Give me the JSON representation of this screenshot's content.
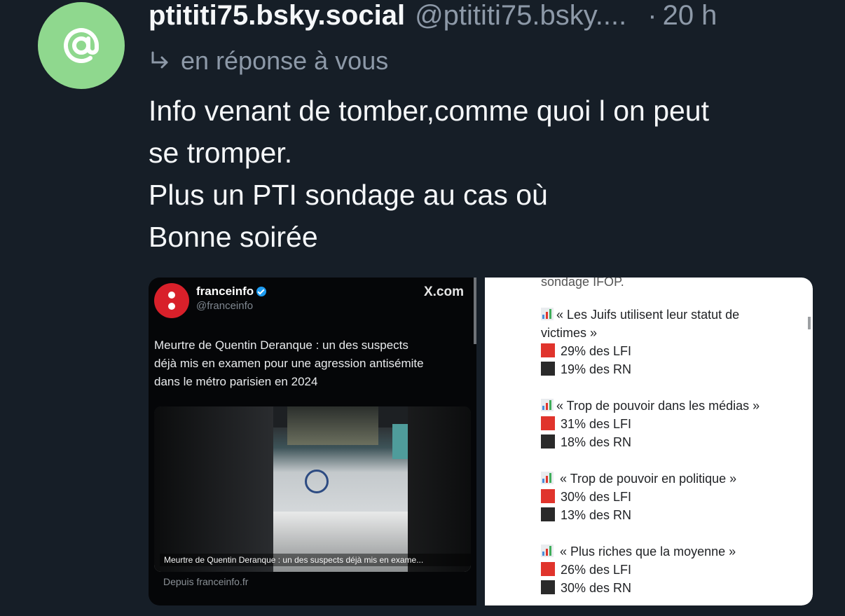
{
  "post": {
    "display_name": "ptititi75.bsky.social",
    "handle": "@ptititi75.bsky....",
    "separator": "·",
    "time": "20 h",
    "avatar_symbol": "@",
    "reply_text": "en réponse à vous",
    "body_lines": [
      "Info venant de tomber,comme quoi l on peut",
      "se tromper.",
      "Plus un PTI sondage au cas où",
      "Bonne soirée"
    ]
  },
  "media_left": {
    "account_name": "franceinfo",
    "account_handle": "@franceinfo",
    "site": "X.com",
    "headline_lines": [
      "Meurtre de Quentin Deranque : un des suspects",
      "déjà mis en examen pour une agression antisémite",
      "dans le métro parisien en 2024"
    ],
    "card_caption": "Meurtre de Quentin Deranque : un des suspects déjà mis en exame...",
    "source": "Depuis franceinfo.fr"
  },
  "media_right": {
    "top_partial": "sondage IFOP.",
    "items": [
      {
        "question_lines": [
          "« Les Juifs utilisent leur statut de",
          "victimes »"
        ],
        "lfi": "29% des LFI",
        "rn": "19% des RN"
      },
      {
        "question_lines": [
          "« Trop de pouvoir dans les médias »"
        ],
        "lfi": "31% des LFI",
        "rn": "18% des RN"
      },
      {
        "question_lines": [
          " « Trop de pouvoir en politique »"
        ],
        "lfi": "30% des LFI",
        "rn": "13% des RN"
      },
      {
        "question_lines": [
          " « Plus riches que la moyenne »"
        ],
        "lfi": "26% des LFI",
        "rn": "30% des RN"
      }
    ]
  },
  "colors": {
    "background": "#161e27",
    "avatar": "#8fd88e",
    "muted_text": "#8d99a8",
    "red_square": "#e0342c",
    "black_square": "#2a2a2a"
  }
}
